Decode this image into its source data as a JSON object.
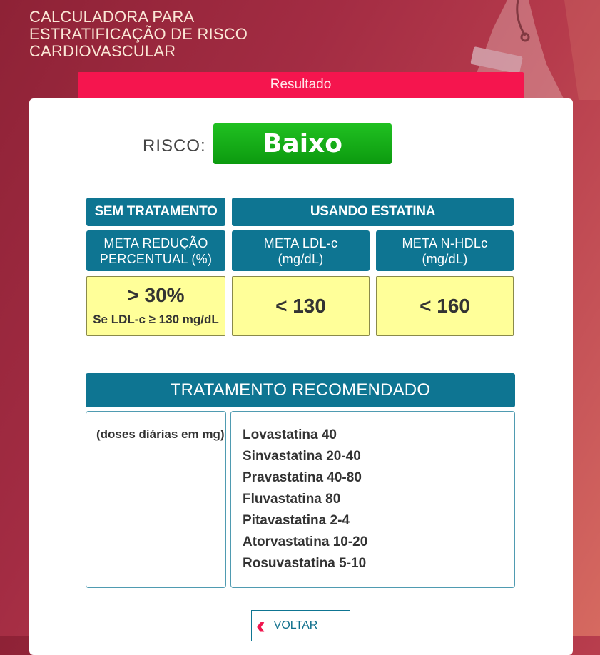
{
  "header": {
    "title": "CALCULADORA PARA\nESTRATIFICAÇÃO DE RISCO\nCARDIOVASCULAR"
  },
  "result_tab": {
    "label": "Resultado"
  },
  "risk": {
    "label": "RISCO:",
    "value": "Baixo",
    "color": "#12a815"
  },
  "goals": {
    "sem_tratamento": {
      "header": "SEM TRATAMENTO",
      "subheader_line1": "META REDUÇÃO",
      "subheader_line2": "PERCENTUAL  (%)",
      "value": "> 30%",
      "note": "Se LDL-c ≥ 130 mg/dL"
    },
    "usando_estatina": {
      "header": "USANDO ESTATINA",
      "ldl": {
        "line1": "META LDL-c",
        "line2": "(mg/dL)",
        "value": "< 130"
      },
      "nhdl": {
        "line1": "META N-HDLc",
        "line2": "(mg/dL)",
        "value": "< 160"
      }
    }
  },
  "treatment": {
    "header": "TRATAMENTO RECOMENDADO",
    "doses_label": "(doses diárias em mg)",
    "drugs": [
      "Lovastatina 40",
      "Sinvastatina 20-40",
      "Pravastatina 40-80",
      "Fluvastatina 80",
      "Pitavastatina 2-4",
      "Atorvastatina 10-20",
      "Rosuvastatina 5-10"
    ]
  },
  "back_button": {
    "label": "VOLTAR",
    "icon": "double-chevron-left-icon"
  },
  "colors": {
    "accent": "#f5154e",
    "teal": "#0e7592",
    "highlight": "#ffff99"
  }
}
